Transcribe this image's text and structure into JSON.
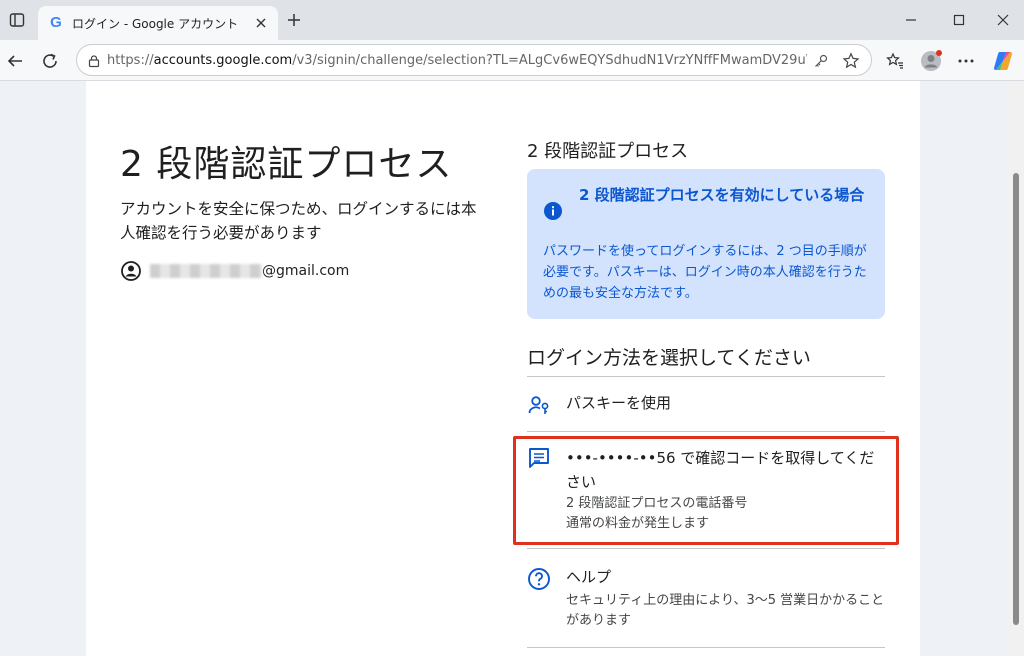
{
  "browser": {
    "tab_title": "ログイン - Google アカウント",
    "tab_favicon": "G",
    "url_prefix": "https://",
    "url_host": "accounts.google.com",
    "url_path": "/v3/signin/challenge/selection?TL=ALgCv6wEQYSdhudN1VrzYNffFMwamDV29uW..."
  },
  "left": {
    "title": "2 段階認証プロセス",
    "subtitle": "アカウントを安全に保つため、ログインするには本人確認を行う必要があります",
    "email_domain": "@gmail.com"
  },
  "right": {
    "title": "2 段階認証プロセス",
    "info": {
      "heading": "2 段階認証プロセスを有効にしている場合",
      "body": "パスワードを使ってログインするには、2 つ目の手順が必要です。パスキーは、ログイン時の本人確認を行うための最も安全な方法です。"
    },
    "choose_heading": "ログイン方法を選択してください",
    "options": [
      {
        "title": "パスキーを使用",
        "icon": "passkey-icon"
      },
      {
        "title": "•••-••••-••56 で確認コードを取得してください",
        "desc": "2 段階認証プロセスの電話番号\n通常の料金が発生します",
        "icon": "sms-icon"
      },
      {
        "title": "ヘルプ",
        "desc": "セキュリティ上の理由により、3〜5 営業日かかることがあります",
        "icon": "help-icon"
      }
    ]
  },
  "colors": {
    "accent": "#0b57d0",
    "info_bg": "#d3e3fd",
    "highlight": "#e0311e"
  }
}
